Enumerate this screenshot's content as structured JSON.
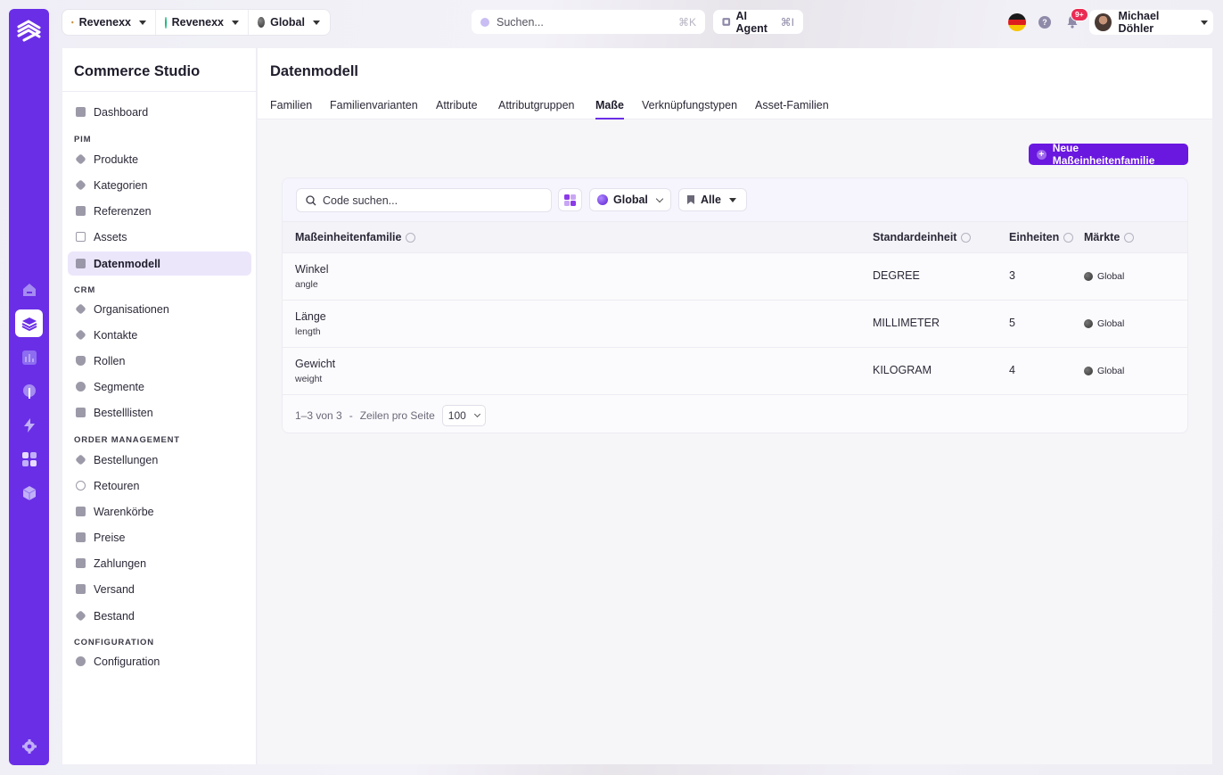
{
  "topbar": {
    "scopes": [
      {
        "label": "Revenexx",
        "icon": "revenexx-logo-icon"
      },
      {
        "label": "Revenexx",
        "icon": "green-dot-icon",
        "color": "#1fb97b"
      },
      {
        "label": "Global",
        "icon": "globe-icon"
      }
    ],
    "search_placeholder": "Suchen...",
    "search_shortcut": "⌘K",
    "ai_agent_label": "AI Agent",
    "ai_agent_shortcut": "⌘I",
    "notification_count": "9+",
    "user_name": "Michael Döhler",
    "help_label": "?"
  },
  "sidebar": {
    "title": "Commerce Studio",
    "items": [
      {
        "label": "Dashboard"
      },
      {
        "section": "PIM"
      },
      {
        "label": "Produkte"
      },
      {
        "label": "Kategorien"
      },
      {
        "label": "Referenzen"
      },
      {
        "label": "Assets"
      },
      {
        "label": "Datenmodell",
        "active": true
      },
      {
        "section": "CRM"
      },
      {
        "label": "Organisationen"
      },
      {
        "label": "Kontakte"
      },
      {
        "label": "Rollen"
      },
      {
        "label": "Segmente"
      },
      {
        "label": "Bestelllisten"
      },
      {
        "section": "ORDER MANAGEMENT"
      },
      {
        "label": "Bestellungen"
      },
      {
        "label": "Retouren"
      },
      {
        "label": "Warenkörbe"
      },
      {
        "label": "Preise"
      },
      {
        "label": "Zahlungen"
      },
      {
        "label": "Versand"
      },
      {
        "label": "Bestand"
      },
      {
        "section": "CONFIGURATION"
      },
      {
        "label": "Configuration"
      }
    ]
  },
  "main": {
    "title": "Datenmodell",
    "tabs": [
      "Familien",
      "Familienvarianten",
      "Attribute",
      "Attributgruppen",
      "Maße",
      "Verknüpfungstypen",
      "Asset-Familien"
    ],
    "active_tab": "Maße",
    "new_button_label": "Neue Maßeinheitenfamilie",
    "toolbar": {
      "search_placeholder": "Code suchen...",
      "market_filter": "Global",
      "status_filter": "Alle"
    },
    "table": {
      "columns": [
        "Maßeinheitenfamilie",
        "Standardeinheit",
        "Einheiten",
        "Märkte"
      ],
      "rows": [
        {
          "name": "Winkel",
          "code": "angle",
          "standard_unit": "DEGREE",
          "units": "3",
          "market": "Global"
        },
        {
          "name": "Länge",
          "code": "length",
          "standard_unit": "MILLIMETER",
          "units": "5",
          "market": "Global"
        },
        {
          "name": "Gewicht",
          "code": "weight",
          "standard_unit": "KILOGRAM",
          "units": "4",
          "market": "Global"
        }
      ]
    },
    "pagination": {
      "range": "1–3 von 3",
      "separator": "-",
      "rows_per_page_label": "Zeilen pro Seite",
      "rows_per_page_value": "100"
    }
  },
  "colors": {
    "accent": "#6a2ee6",
    "button": "#6a17e0",
    "active_nav_bg": "#ece6fb"
  }
}
